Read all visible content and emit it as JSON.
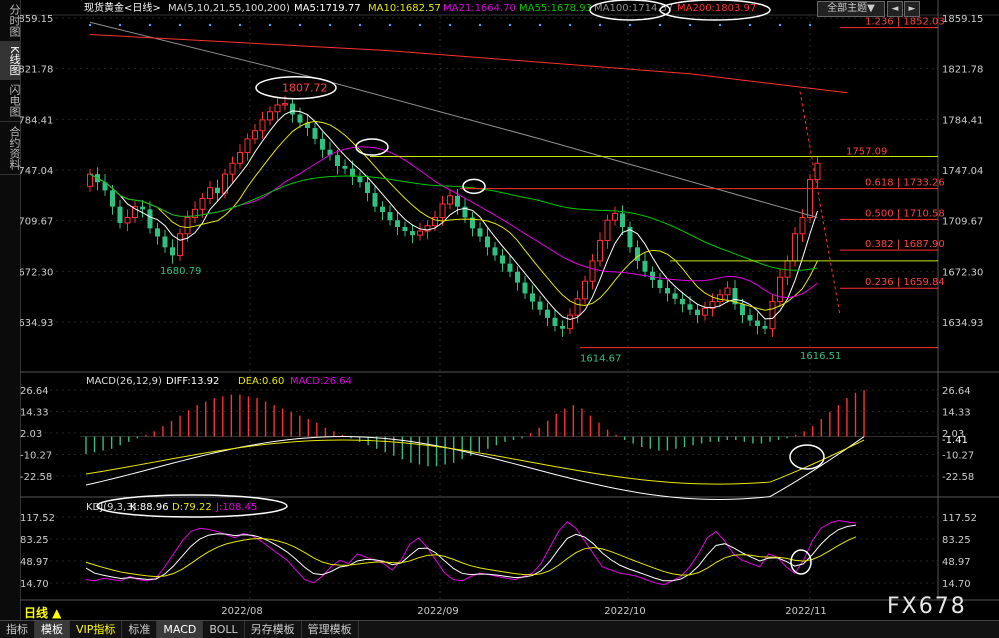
{
  "sidebar": {
    "tabs": [
      {
        "label": "分时图",
        "active": false
      },
      {
        "label": "K线图",
        "active": true
      },
      {
        "label": "闪电图",
        "active": false
      },
      {
        "label": "合约资料",
        "active": false
      }
    ]
  },
  "header": {
    "instrument": "现货黄金<日线>",
    "ma_params": "MA(5,10,21,55,100,200)",
    "ma": [
      {
        "label": "MA5:1719.77",
        "color": "#ffffff"
      },
      {
        "label": "MA10:1682.57",
        "color": "#e8e800"
      },
      {
        "label": "MA21:1664.70",
        "color": "#e000e0"
      },
      {
        "label": "MA55:1678.93",
        "color": "#00c800"
      },
      {
        "label": "MA100:1714.57",
        "color": "#909090"
      },
      {
        "label": "MA200:1803.97",
        "color": "#ff3030"
      }
    ],
    "theme_button": "全部主题",
    "theme_arrow": "▼",
    "scroll_left": "◄",
    "scroll_right": "►"
  },
  "price_axis": [
    "1859.15",
    "1821.78",
    "1784.41",
    "1747.04",
    "1709.67",
    "1672.30",
    "1634.93"
  ],
  "macd_axis": [
    "26.64",
    "14.33",
    "2.03",
    "-10.27",
    "-22.58"
  ],
  "macd_current": "-1.41",
  "kdj_axis": [
    "117.52",
    "83.25",
    "48.97",
    "14.70"
  ],
  "annotations": {
    "high_label": "1807.72",
    "low1_label": "1680.79",
    "low2_label": "1614.67",
    "low3_label": "1616.51",
    "latest_high": "1757.09",
    "fib": [
      "1.236 | 1852.03",
      "0.618 | 1733.26",
      "0.500 | 1710.58",
      "0.382 | 1687.90",
      "0.236 | 1659.84"
    ]
  },
  "macd_header": {
    "params": "MACD(26,12,9)",
    "diff": "DIFF:13.92",
    "dea": "DEA:0.60",
    "macd": "MACD:26.64"
  },
  "kdj_header": {
    "params": "KDJ(9,3,3)",
    "k": "K:88.96",
    "d": "D:79.22",
    "j": "J:108.45"
  },
  "date_axis": [
    "2022/08",
    "2022/09",
    "2022/10",
    "2022/11"
  ],
  "period_label": "日线 ▲",
  "watermark": "FX678",
  "bottom_tabs": [
    {
      "label": "指标",
      "active": false
    },
    {
      "label": "模板",
      "active": true
    },
    {
      "label": "VIP指标",
      "active": false,
      "yellow": true
    },
    {
      "label": "标准",
      "active": false
    },
    {
      "label": "MACD",
      "active": true
    },
    {
      "label": "BOLL",
      "active": false
    },
    {
      "label": "另存模板",
      "active": false
    },
    {
      "label": "管理模板",
      "active": false
    }
  ],
  "colors": {
    "up": "#ff3030",
    "down": "#30c080",
    "ma5": "#ffffff",
    "ma10": "#e8e800",
    "ma21": "#e000e0",
    "ma55": "#00c800",
    "ma100": "#909090",
    "ma200": "#ff3030"
  }
}
